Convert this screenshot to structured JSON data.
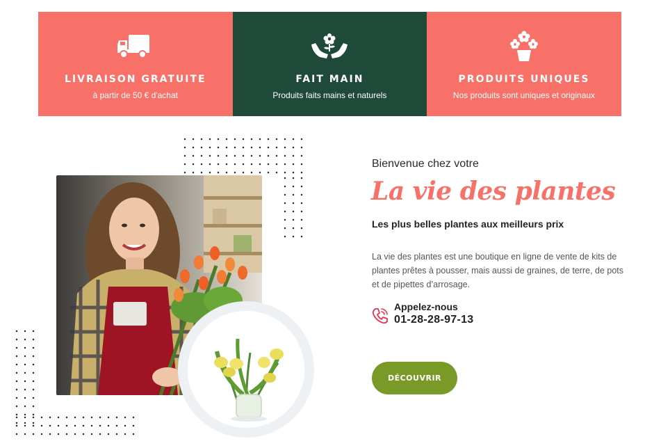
{
  "features": [
    {
      "icon": "truck-icon",
      "title": "LIVRAISON GRATUITE",
      "subtitle": "à partir de 50 € d'achat",
      "color": "#f87169"
    },
    {
      "icon": "hands-flower-icon",
      "title": "FAIT MAIN",
      "subtitle": "Produits faits mains et naturels",
      "color": "#1f4a39"
    },
    {
      "icon": "flower-pot-icon",
      "title": "PRODUITS UNIQUES",
      "subtitle": "Nos produits sont uniques et originaux",
      "color": "#f87169"
    }
  ],
  "intro": {
    "welcome": "Bienvenue chez votre",
    "brand": "La vie des plantes",
    "tagline": "Les plus belles plantes aux meilleurs prix",
    "description": "La vie des plantes est une boutique en ligne de vente de kits de plantes prêtes à pousser, mais aussi de graines, de terre, de pots et de pipettes d’arrosage."
  },
  "contact": {
    "icon": "phone-icon",
    "label": "Appelez-nous",
    "phone": "01-28-28-97-13"
  },
  "cta": {
    "label": "DÉCOUVRIR",
    "color": "#7a9a27"
  },
  "colors": {
    "accent": "#f87169",
    "dark_green": "#1f4a39",
    "olive": "#7a9a27"
  }
}
